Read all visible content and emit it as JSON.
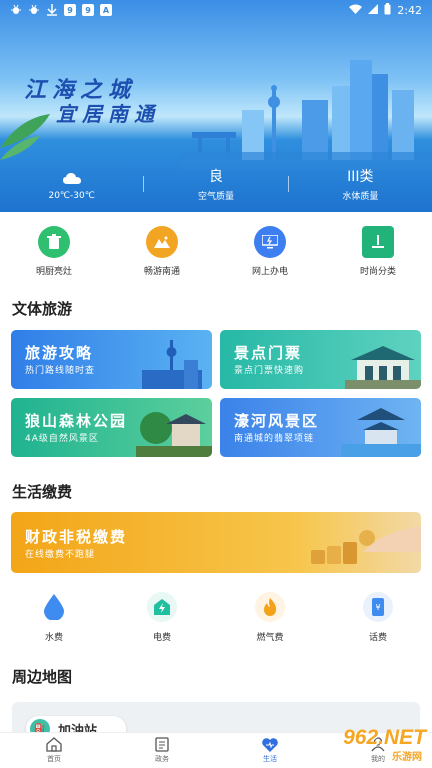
{
  "status_bar": {
    "time": "2:42"
  },
  "banner": {
    "line1": "江海之城",
    "line2": "宜居南通",
    "weather": [
      {
        "top_icon": "cloud-icon",
        "bottom": "20℃-30℃"
      },
      {
        "top": "良",
        "bottom": "空气质量"
      },
      {
        "top": "III类",
        "bottom": "水体质量"
      }
    ]
  },
  "quick_links": [
    {
      "label": "明厨亮灶",
      "icon": "trash-bin-icon",
      "color": "#2fbf71"
    },
    {
      "label": "畅游南通",
      "icon": "mountain-icon",
      "color": "#f2a423"
    },
    {
      "label": "网上办电",
      "icon": "monitor-icon",
      "color": "#3d7ff0"
    },
    {
      "label": "时尚分类",
      "icon": "bin-icon",
      "color": "#22b37a"
    }
  ],
  "culture": {
    "title": "文体旅游",
    "cards": [
      {
        "title": "旅游攻略",
        "sub": "热门路线随时查"
      },
      {
        "title": "景点门票",
        "sub": "景点门票快速购"
      },
      {
        "title": "狼山森林公园",
        "sub": "4A级自然风景区"
      },
      {
        "title": "濠河风景区",
        "sub": "南通城的翡翠项链"
      }
    ]
  },
  "payment": {
    "title": "生活缴费",
    "banner_title": "财政非税缴费",
    "banner_sub": "在线缴费不跑腿",
    "items": [
      {
        "label": "水费",
        "icon": "water-drop-icon"
      },
      {
        "label": "电费",
        "icon": "electricity-icon"
      },
      {
        "label": "燃气费",
        "icon": "flame-icon"
      },
      {
        "label": "话费",
        "icon": "phone-bill-icon"
      }
    ]
  },
  "nearby": {
    "title": "周边地图",
    "pill_label": "加油站"
  },
  "tabs": [
    {
      "label": "首页",
      "icon": "home-icon"
    },
    {
      "label": "政务",
      "icon": "document-icon"
    },
    {
      "label": "生活",
      "icon": "heart-icon",
      "active": true
    },
    {
      "label": "我的",
      "icon": "user-icon"
    }
  ],
  "watermark": {
    "text": "962.NET",
    "sub": "乐游网"
  }
}
